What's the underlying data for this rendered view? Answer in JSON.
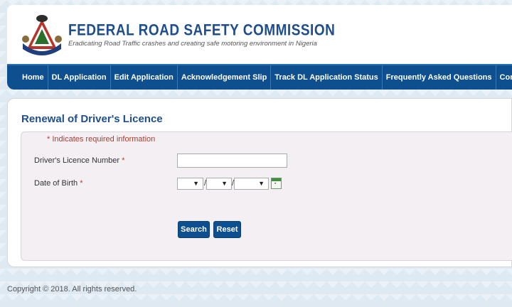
{
  "header": {
    "org_name": "FEDERAL ROAD SAFETY COMMISSION",
    "tagline": "Eradicating Road Traffic crashes and creating safe motoring environment in Nigeria",
    "logo_icon": "frsc-crest-icon"
  },
  "nav": {
    "items": [
      {
        "label": "Home"
      },
      {
        "label": "DL Application"
      },
      {
        "label": "Edit Application"
      },
      {
        "label": "Acknowledgement Slip"
      },
      {
        "label": "Track DL Application Status"
      },
      {
        "label": "Frequently Asked Questions"
      },
      {
        "label": "Contact"
      }
    ]
  },
  "page": {
    "title": "Renewal of Driver's Licence"
  },
  "form": {
    "required_note": "* Indicates required information",
    "licence_label": "Driver's Licence Number",
    "licence_value": "",
    "dob_label": "Date of Birth",
    "required_star": "*",
    "date_separator": "/",
    "dropdown_arrow": "▼",
    "search_label": "Search",
    "reset_label": "Reset"
  },
  "footer": {
    "copyright": "Copyright © 2018. All rights reserved."
  },
  "colors": {
    "brand_blue": "#0d4f8f",
    "title_blue": "#1f4e8c",
    "required_red": "#c0392b"
  }
}
